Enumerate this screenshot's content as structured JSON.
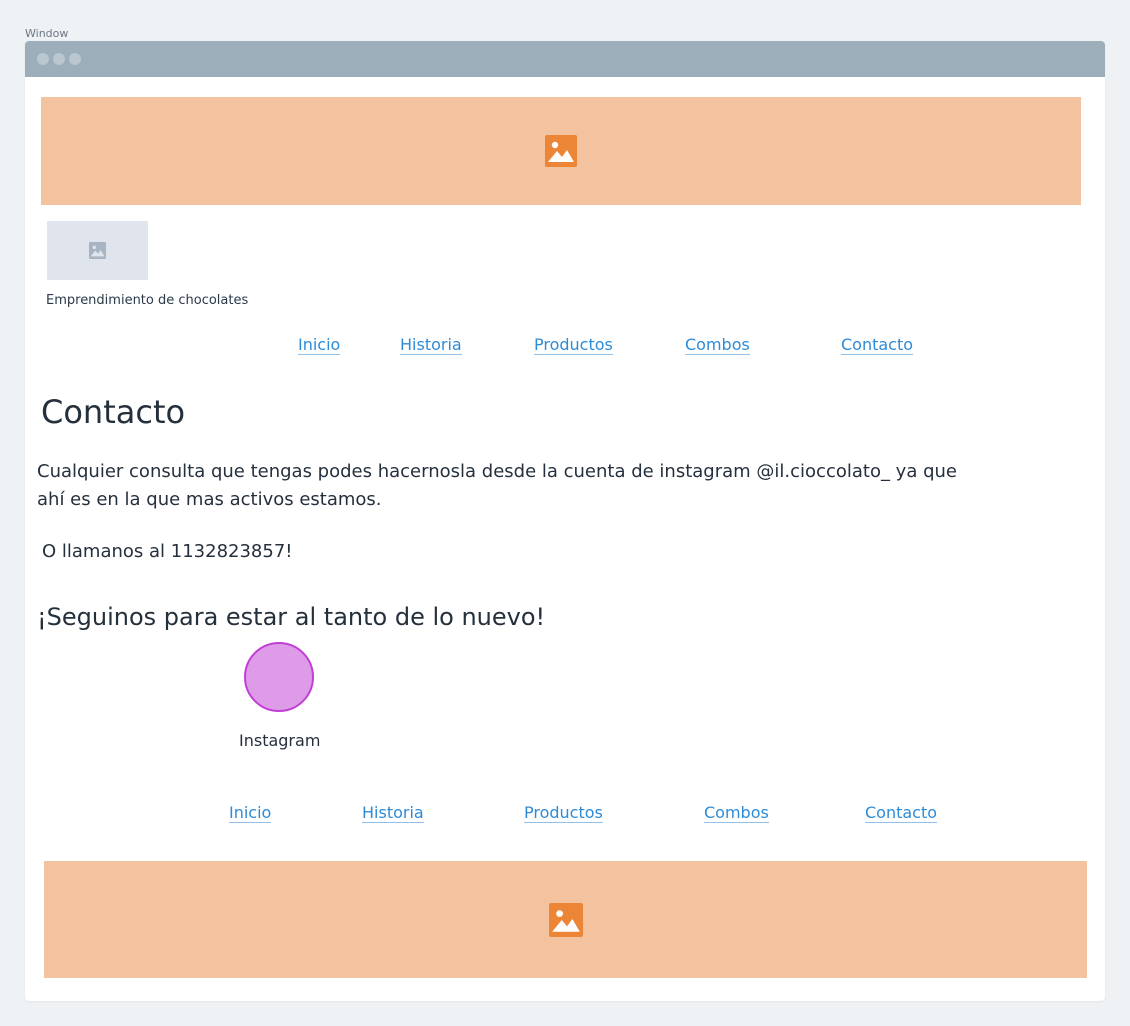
{
  "window": {
    "label": "Window"
  },
  "header": {
    "banner_icon": "image-icon",
    "logo_icon": "image-icon",
    "logo_caption": "Emprendimiento de chocolates"
  },
  "nav_top": [
    "Inicio",
    "Historia",
    "Productos",
    "Combos",
    "Contacto"
  ],
  "main": {
    "title": "Contacto",
    "paragraph": "Cualquier consulta que tengas podes hacernosla desde la cuenta de instagram @il.cioccolato_ ya que ahí es en la que mas activos estamos.",
    "phone_line": "O llamanos al 1132823857!",
    "follow_heading": "¡Seguinos para estar al tanto de lo nuevo!",
    "social": {
      "label": "Instagram",
      "color": "#dd9be8",
      "border_color": "#c23fd6"
    }
  },
  "nav_bottom": [
    "Inicio",
    "Historia",
    "Productos",
    "Combos",
    "Contacto"
  ],
  "footer": {
    "banner_icon": "image-icon"
  },
  "colors": {
    "banner": "#f3c29e",
    "banner_icon": "#ec8536",
    "link": "#2d8bd8",
    "titlebar": "#9daebb"
  }
}
